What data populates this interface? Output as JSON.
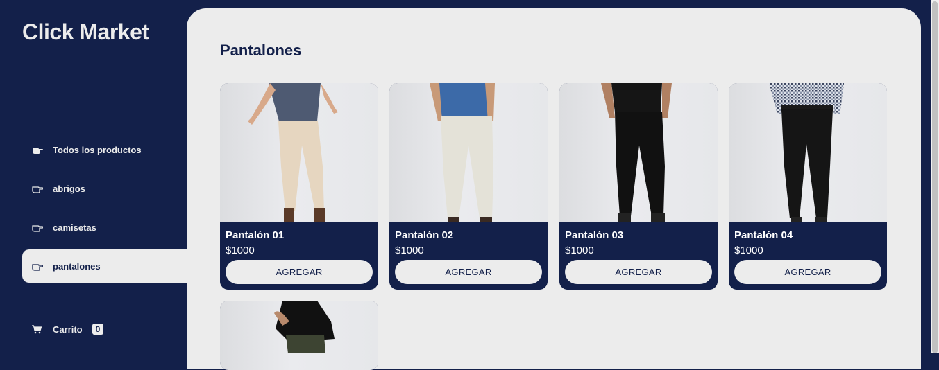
{
  "app": {
    "title": "Click Market"
  },
  "sidebar": {
    "items": [
      {
        "label": "Todos los productos",
        "icon": "hand-pointing-filled-icon"
      },
      {
        "label": "abrigos",
        "icon": "hand-pointing-outline-icon"
      },
      {
        "label": "camisetas",
        "icon": "hand-pointing-outline-icon"
      },
      {
        "label": "pantalones",
        "icon": "hand-pointing-outline-icon",
        "active": true
      }
    ],
    "cart": {
      "label": "Carrito",
      "count": "0",
      "icon": "cart-icon"
    }
  },
  "main": {
    "title": "Pantalones",
    "products": [
      {
        "name": "Pantalón 01",
        "price": "$1000",
        "button": "AGREGAR"
      },
      {
        "name": "Pantalón 02",
        "price": "$1000",
        "button": "AGREGAR"
      },
      {
        "name": "Pantalón 03",
        "price": "$1000",
        "button": "AGREGAR"
      },
      {
        "name": "Pantalón 04",
        "price": "$1000",
        "button": "AGREGAR"
      }
    ]
  },
  "colors": {
    "navy": "#13204a",
    "light": "#ececec"
  }
}
